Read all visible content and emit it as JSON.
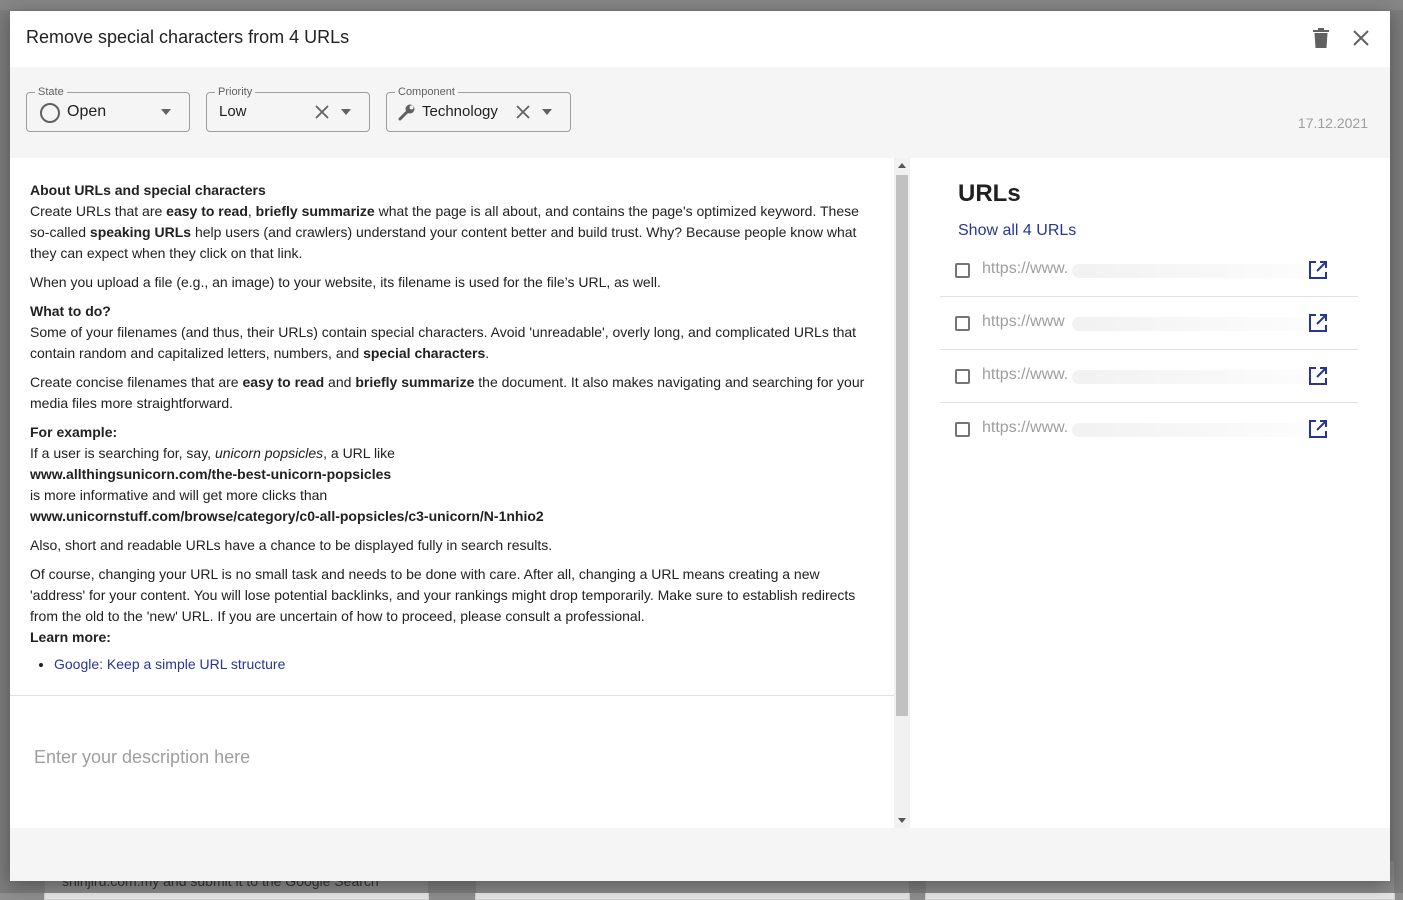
{
  "background": {
    "snippet": "shinjiru.com.my  and submit it to the Google Search"
  },
  "dialog": {
    "title": "Remove special characters from 4 URLs",
    "delete_icon": "trash-icon",
    "close_icon": "close-icon"
  },
  "filters": {
    "state": {
      "legend": "State",
      "value": "Open",
      "icon": "circle-outline-icon"
    },
    "priority": {
      "legend": "Priority",
      "value": "Low"
    },
    "component": {
      "legend": "Component",
      "value": "Technology",
      "icon": "wrench-icon"
    },
    "date": "17.12.2021"
  },
  "description": {
    "h_about": "About URLs and special characters",
    "p1_a": "Create URLs that are ",
    "p1_b": "easy to read",
    "p1_c": ", ",
    "p1_d": "briefly summarize",
    "p1_e": " what the page is all about, and contains the page's optimized keyword. These so-called ",
    "p1_f": "speaking URLs",
    "p1_g": " help users (and crawlers) understand your content better and build trust. Why? Because people know what they can expect when they click on that link.",
    "p2": "When you upload a file (e.g., an image) to your website, its filename is used for the file’s URL, as well.",
    "h_todo": "What to do?",
    "p3_a": "Some of your filenames (and thus, their URLs) contain special characters. Avoid 'unreadable', overly long, and complicated URLs that contain random and capitalized letters, numbers, and ",
    "p3_b": "special characters",
    "p3_c": ".",
    "p4_a": "Create concise filenames that are ",
    "p4_b": "easy to read",
    "p4_c": " and ",
    "p4_d": "briefly summarize",
    "p4_e": " the document. It also makes navigating and searching for your media files more straightforward.",
    "h_example": "For example:",
    "ex1_a": "If a user is searching for, say, ",
    "ex1_b": "unicorn popsicles",
    "ex1_c": ", a URL like",
    "ex_url1": "www.allthingsunicorn.com/the-best-unicorn-popsicles",
    "ex2": "is more informative and will get more clicks than",
    "ex_url2": "www.unicornstuff.com/browse/category/c0-all-popsicles/c3-unicorn/N-1nhio2",
    "p5": "Also, short and readable URLs have a chance to be displayed fully in search results.",
    "p6": "Of course, changing your URL is no small task and needs to be done with care. After all, changing a URL means creating a new 'address' for your content. You will lose potential backlinks, and your rankings might drop temporarily. Make sure to establish redirects from the old to the 'new' URL. If you are uncertain of how to proceed, please consult a professional.",
    "h_learn": "Learn more:",
    "link1": "Google: Keep a simple URL structure",
    "input_placeholder": "Enter your description here"
  },
  "urls": {
    "title": "URLs",
    "show_all": "Show all 4 URLs",
    "items": [
      {
        "text": "https://www."
      },
      {
        "text": "https://www"
      },
      {
        "text": "https://www."
      },
      {
        "text": "https://www."
      }
    ],
    "open_icon": "open-in-new-icon"
  },
  "colors": {
    "link": "#283593",
    "muted": "#9e9e9e",
    "panel_bg": "#f5f5f5"
  }
}
